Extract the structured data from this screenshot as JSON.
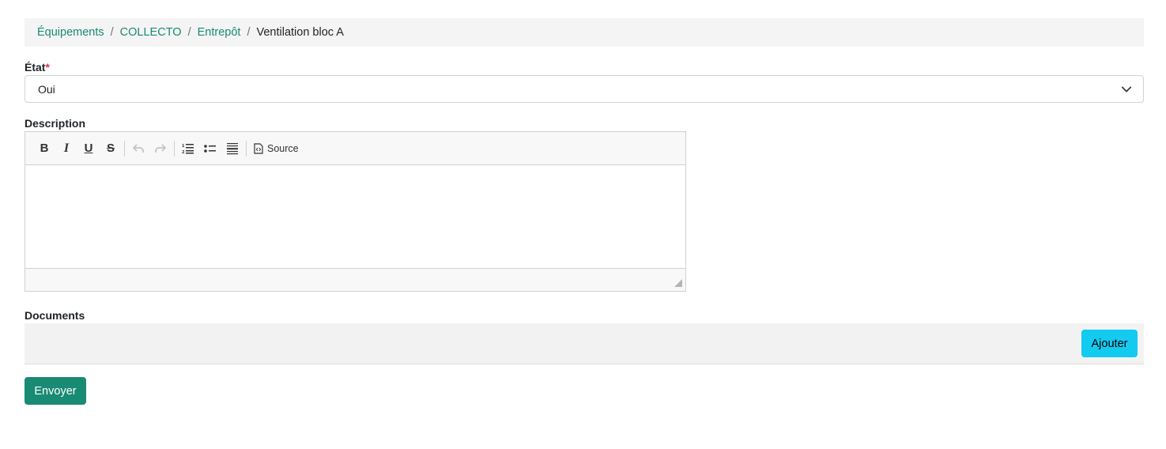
{
  "breadcrumb": {
    "items": [
      "Équipements",
      "COLLECTO",
      "Entrepôt"
    ],
    "separator": "/",
    "current": "Ventilation bloc A"
  },
  "form": {
    "etat": {
      "label": "État",
      "required_marker": "*",
      "value": "Oui"
    },
    "description": {
      "label": "Description",
      "toolbar": {
        "buttons": [
          "bold-icon",
          "italic-icon",
          "underline-icon",
          "strikethrough-icon",
          "undo-icon",
          "redo-icon",
          "numbered-list-icon",
          "bulleted-list-icon",
          "horizontal-line-icon",
          "source-icon"
        ],
        "bold": "B",
        "italic": "I",
        "underline": "U",
        "strike": "S",
        "source_label": "Source"
      },
      "content": ""
    },
    "documents": {
      "label": "Documents",
      "add_label": "Ajouter"
    },
    "submit_label": "Envoyer"
  },
  "colors": {
    "link": "#198a74",
    "primary": "#198a74",
    "info": "#13caf0",
    "required": "#dc3545"
  }
}
